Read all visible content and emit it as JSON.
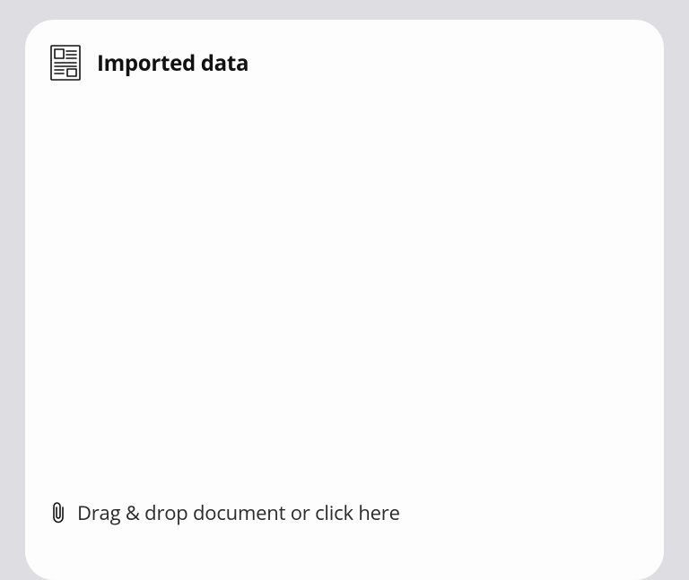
{
  "header": {
    "title": "Imported data",
    "icon": "document-layout-icon"
  },
  "dropzone": {
    "icon": "paperclip-icon",
    "text": "Drag & drop document or click here"
  }
}
